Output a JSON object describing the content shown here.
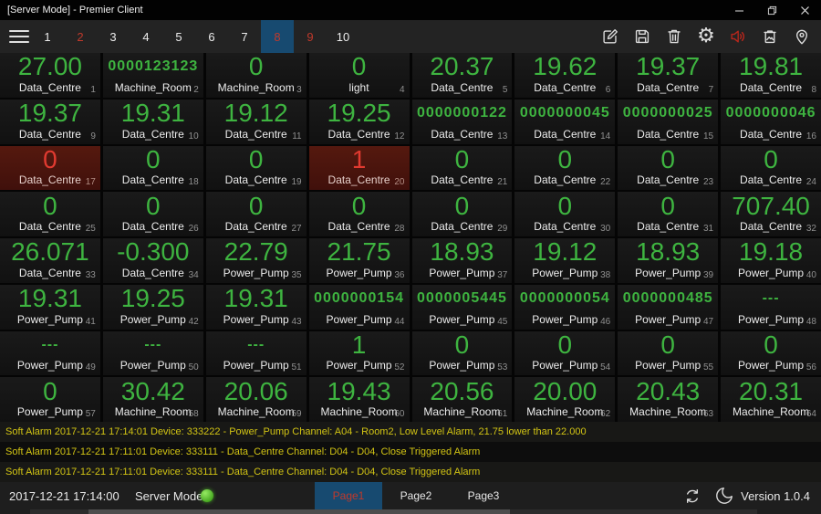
{
  "window": {
    "title": "[Server Mode] - Premier Client",
    "controls": [
      "minimize",
      "restore",
      "close"
    ]
  },
  "toolbar": {
    "menu_icon": "hamburger-menu-icon",
    "tabs": [
      {
        "label": "1"
      },
      {
        "label": "2",
        "alarm": true
      },
      {
        "label": "3"
      },
      {
        "label": "4"
      },
      {
        "label": "5"
      },
      {
        "label": "6"
      },
      {
        "label": "7"
      },
      {
        "label": "8",
        "alarm": true,
        "selected": true
      },
      {
        "label": "9",
        "alarm": true
      },
      {
        "label": "10"
      }
    ],
    "icons": [
      "edit-icon",
      "save-icon",
      "delete-icon",
      "settings-gear-icon",
      "sound-on-icon",
      "snapshot-bin-icon",
      "location-pin-icon"
    ]
  },
  "grid": {
    "cells": [
      {
        "v": "27.00",
        "l": "Data_Centre",
        "i": "1"
      },
      {
        "v": "0000123123",
        "l": "Machine_Room",
        "i": "2",
        "s": "sm"
      },
      {
        "v": "0",
        "l": "Machine_Room",
        "i": "3"
      },
      {
        "v": "0",
        "l": "light",
        "i": "4"
      },
      {
        "v": "20.37",
        "l": "Data_Centre",
        "i": "5"
      },
      {
        "v": "19.62",
        "l": "Data_Centre",
        "i": "6"
      },
      {
        "v": "19.37",
        "l": "Data_Centre",
        "i": "7"
      },
      {
        "v": "19.81",
        "l": "Data_Centre",
        "i": "8"
      },
      {
        "v": "19.37",
        "l": "Data_Centre",
        "i": "9"
      },
      {
        "v": "19.31",
        "l": "Data_Centre",
        "i": "10"
      },
      {
        "v": "19.12",
        "l": "Data_Centre",
        "i": "11"
      },
      {
        "v": "19.25",
        "l": "Data_Centre",
        "i": "12"
      },
      {
        "v": "0000000122",
        "l": "Data_Centre",
        "i": "13",
        "s": "sm"
      },
      {
        "v": "0000000045",
        "l": "Data_Centre",
        "i": "14",
        "s": "sm"
      },
      {
        "v": "0000000025",
        "l": "Data_Centre",
        "i": "15",
        "s": "sm"
      },
      {
        "v": "0000000046",
        "l": "Data_Centre",
        "i": "16",
        "s": "sm"
      },
      {
        "v": "0",
        "l": "Data_Centre",
        "i": "17",
        "a": true
      },
      {
        "v": "0",
        "l": "Data_Centre",
        "i": "18"
      },
      {
        "v": "0",
        "l": "Data_Centre",
        "i": "19"
      },
      {
        "v": "1",
        "l": "Data_Centre",
        "i": "20",
        "a": true
      },
      {
        "v": "0",
        "l": "Data_Centre",
        "i": "21"
      },
      {
        "v": "0",
        "l": "Data_Centre",
        "i": "22"
      },
      {
        "v": "0",
        "l": "Data_Centre",
        "i": "23"
      },
      {
        "v": "0",
        "l": "Data_Centre",
        "i": "24"
      },
      {
        "v": "0",
        "l": "Data_Centre",
        "i": "25"
      },
      {
        "v": "0",
        "l": "Data_Centre",
        "i": "26"
      },
      {
        "v": "0",
        "l": "Data_Centre",
        "i": "27"
      },
      {
        "v": "0",
        "l": "Data_Centre",
        "i": "28"
      },
      {
        "v": "0",
        "l": "Data_Centre",
        "i": "29"
      },
      {
        "v": "0",
        "l": "Data_Centre",
        "i": "30"
      },
      {
        "v": "0",
        "l": "Data_Centre",
        "i": "31"
      },
      {
        "v": "707.40",
        "l": "Data_Centre",
        "i": "32"
      },
      {
        "v": "26.071",
        "l": "Data_Centre",
        "i": "33"
      },
      {
        "v": "-0.300",
        "l": "Data_Centre",
        "i": "34"
      },
      {
        "v": "22.79",
        "l": "Power_Pump",
        "i": "35"
      },
      {
        "v": "21.75",
        "l": "Power_Pump",
        "i": "36"
      },
      {
        "v": "18.93",
        "l": "Power_Pump",
        "i": "37"
      },
      {
        "v": "19.12",
        "l": "Power_Pump",
        "i": "38"
      },
      {
        "v": "18.93",
        "l": "Power_Pump",
        "i": "39"
      },
      {
        "v": "19.18",
        "l": "Power_Pump",
        "i": "40"
      },
      {
        "v": "19.31",
        "l": "Power_Pump",
        "i": "41"
      },
      {
        "v": "19.25",
        "l": "Power_Pump",
        "i": "42"
      },
      {
        "v": "19.31",
        "l": "Power_Pump",
        "i": "43"
      },
      {
        "v": "0000000154",
        "l": "Power_Pump",
        "i": "44",
        "s": "sm"
      },
      {
        "v": "0000005445",
        "l": "Power_Pump",
        "i": "45",
        "s": "sm"
      },
      {
        "v": "0000000054",
        "l": "Power_Pump",
        "i": "46",
        "s": "sm"
      },
      {
        "v": "0000000485",
        "l": "Power_Pump",
        "i": "47",
        "s": "sm"
      },
      {
        "v": "---",
        "l": "Power_Pump",
        "i": "48",
        "s": "sm"
      },
      {
        "v": "---",
        "l": "Power_Pump",
        "i": "49",
        "s": "sm"
      },
      {
        "v": "---",
        "l": "Power_Pump",
        "i": "50",
        "s": "sm"
      },
      {
        "v": "---",
        "l": "Power_Pump",
        "i": "51",
        "s": "sm"
      },
      {
        "v": "1",
        "l": "Power_Pump",
        "i": "52"
      },
      {
        "v": "0",
        "l": "Power_Pump",
        "i": "53"
      },
      {
        "v": "0",
        "l": "Power_Pump",
        "i": "54"
      },
      {
        "v": "0",
        "l": "Power_Pump",
        "i": "55"
      },
      {
        "v": "0",
        "l": "Power_Pump",
        "i": "56"
      },
      {
        "v": "0",
        "l": "Power_Pump",
        "i": "57"
      },
      {
        "v": "30.42",
        "l": "Machine_Room",
        "i": "58"
      },
      {
        "v": "20.06",
        "l": "Machine_Room",
        "i": "59"
      },
      {
        "v": "19.43",
        "l": "Machine_Room",
        "i": "60"
      },
      {
        "v": "20.56",
        "l": "Machine_Room",
        "i": "61"
      },
      {
        "v": "20.00",
        "l": "Machine_Room",
        "i": "62"
      },
      {
        "v": "20.43",
        "l": "Machine_Room",
        "i": "63"
      },
      {
        "v": "20.31",
        "l": "Machine_Room",
        "i": "64"
      }
    ]
  },
  "alarms": [
    "Soft Alarm 2017-12-21 17:14:01 Device: 333222 - Power_Pump Channel: A04 - Room2, Low Level Alarm, 21.75 lower than 22.000",
    "Soft Alarm 2017-12-21 17:11:01 Device: 333111 - Data_Centre Channel: D04 - D04, Close Triggered Alarm",
    "Soft Alarm 2017-12-21 17:11:01 Device: 333111 - Data_Centre Channel: D04 - D04, Close Triggered Alarm"
  ],
  "statusbar": {
    "datetime": "2017-12-21 17:14:00",
    "mode_label": "Server Mode",
    "led": "green",
    "pages": [
      {
        "label": "Page1",
        "selected": true
      },
      {
        "label": "Page2"
      },
      {
        "label": "Page3"
      }
    ],
    "icons": [
      "sync-icon",
      "night-mode-moon-icon"
    ],
    "version": "Version 1.0.4"
  },
  "colors": {
    "accent_green": "#3eb440",
    "alarm_red_text": "#e03a30",
    "selected_blue": "#174a70",
    "tab_red": "#c0392b",
    "alarm_yellow": "#d2c414",
    "led_green": "#44a61f",
    "icon_red": "#b8261c"
  }
}
